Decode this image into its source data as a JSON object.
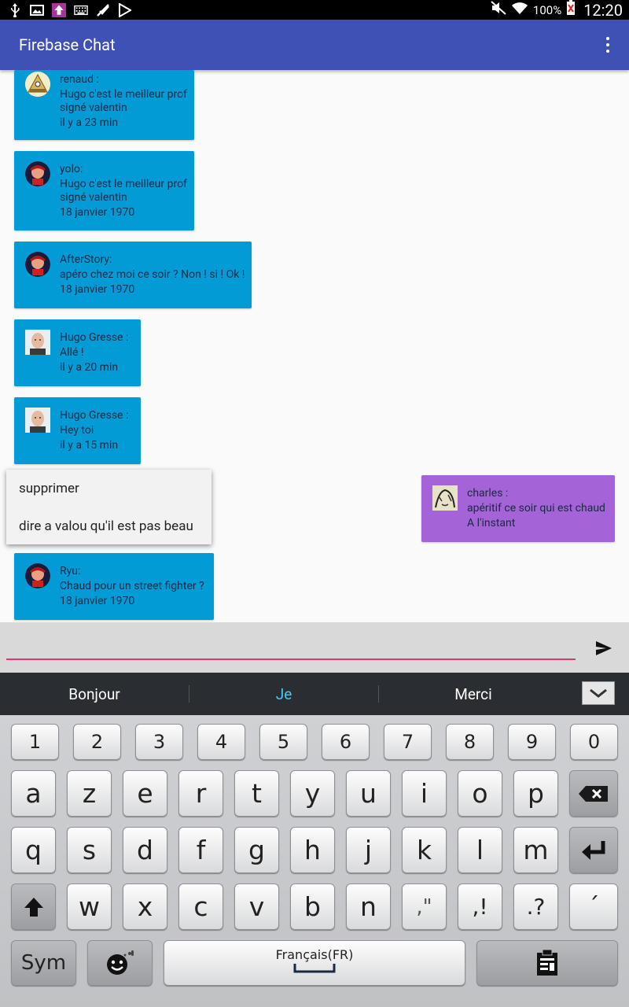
{
  "status_bar": {
    "battery": "100%",
    "time": "12:20"
  },
  "app_bar": {
    "title": "Firebase Chat"
  },
  "messages": [
    {
      "author": "renaud :",
      "lines": [
        "Hugo c'est le meilleur prof",
        "signé valentin"
      ],
      "time": "il y a 23 min"
    },
    {
      "author": "yolo:",
      "lines": [
        "Hugo c'est le meilleur prof",
        "signé valentin"
      ],
      "time": "18 janvier 1970"
    },
    {
      "author": "AfterStory:",
      "lines": [
        "apéro chez moi ce soir ? Non ! si ! Ok !"
      ],
      "time": "18 janvier 1970"
    },
    {
      "author": "Hugo Gresse :",
      "lines": [
        "Allé !"
      ],
      "time": "il y a 20 min"
    },
    {
      "author": "Hugo Gresse :",
      "lines": [
        "Hey toi"
      ],
      "time": "il y a 15 min"
    },
    {
      "author": "charles :",
      "lines": [
        "apéritif ce soir qui est chaud"
      ],
      "time": "A l'instant"
    },
    {
      "author": "Ryu:",
      "lines": [
        "Chaud pour un street fighter ?"
      ],
      "time": "18 janvier 1970"
    }
  ],
  "context_menu": {
    "items": [
      "supprimer",
      "dire a valou qu'il est pas beau"
    ]
  },
  "input": {
    "value": "",
    "placeholder": ""
  },
  "suggestions": [
    "Bonjour",
    "Je",
    "Merci"
  ],
  "keyboard": {
    "numbers": [
      "1",
      "2",
      "3",
      "4",
      "5",
      "6",
      "7",
      "8",
      "9",
      "0"
    ],
    "row1": [
      "a",
      "z",
      "e",
      "r",
      "t",
      "y",
      "u",
      "i",
      "o",
      "p"
    ],
    "row2": [
      "q",
      "s",
      "d",
      "f",
      "g",
      "h",
      "j",
      "k",
      "l",
      "m"
    ],
    "row3": [
      "w",
      "x",
      "c",
      "v",
      "b",
      "n"
    ],
    "punct": [
      ",\"",
      ",!",
      ".?",
      "´"
    ],
    "sym_label": "Sym",
    "space_label": "Français(FR)"
  },
  "colors": {
    "appbar": "#3f51b5",
    "bubble_blue": "#039bd5",
    "bubble_purple": "#a463d6",
    "input_underline": "#e9307a"
  }
}
